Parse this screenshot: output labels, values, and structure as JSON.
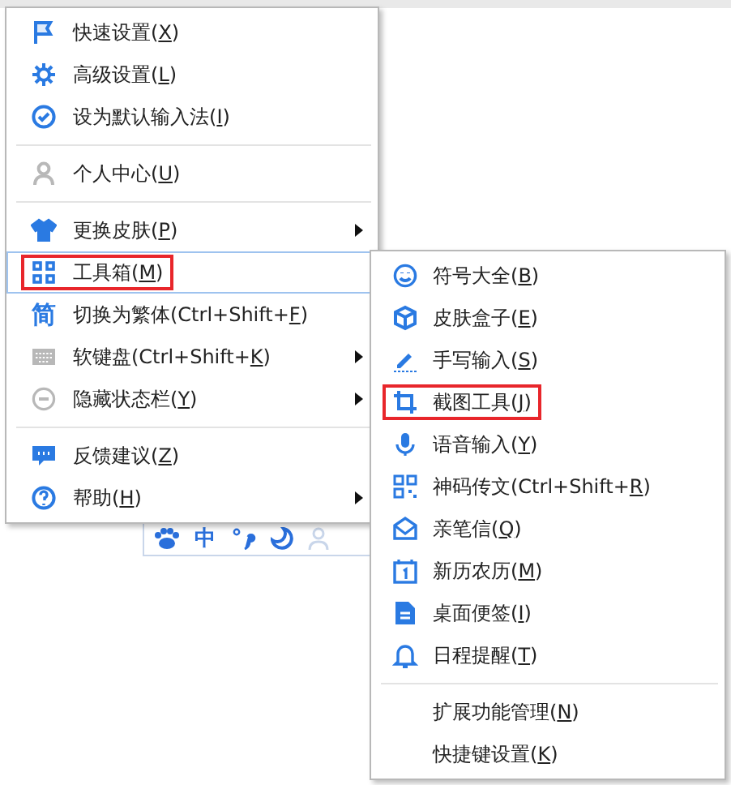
{
  "status_bar": {
    "mode_text": "中"
  },
  "main_menu": {
    "sections": [
      [
        {
          "text_before": "快速设置(",
          "mnemonic": "X",
          "text_after": ")",
          "has_submenu": false,
          "selected": false,
          "outlined": false
        },
        {
          "text_before": "高级设置(",
          "mnemonic": "L",
          "text_after": ")",
          "has_submenu": false,
          "selected": false,
          "outlined": false
        },
        {
          "text_before": "设为默认输入法(",
          "mnemonic": "I",
          "text_after": ")",
          "has_submenu": false,
          "selected": false,
          "outlined": false
        }
      ],
      [
        {
          "text_before": "个人中心(",
          "mnemonic": "U",
          "text_after": ")",
          "has_submenu": false,
          "selected": false,
          "outlined": false
        }
      ],
      [
        {
          "text_before": "更换皮肤(",
          "mnemonic": "P",
          "text_after": ")",
          "has_submenu": true,
          "selected": false,
          "outlined": false
        },
        {
          "text_before": "工具箱(",
          "mnemonic": "M",
          "text_after": ")",
          "has_submenu": false,
          "selected": true,
          "outlined": true
        },
        {
          "glyph": "简",
          "text_before": "切换为繁体(Ctrl+Shift+",
          "mnemonic": "F",
          "text_after": ")",
          "has_submenu": false,
          "selected": false,
          "outlined": false
        },
        {
          "text_before": "软键盘(Ctrl+Shift+",
          "mnemonic": "K",
          "text_after": ")",
          "has_submenu": true,
          "selected": false,
          "outlined": false
        },
        {
          "text_before": "隐藏状态栏(",
          "mnemonic": "Y",
          "text_after": ")",
          "has_submenu": true,
          "selected": false,
          "outlined": false
        }
      ],
      [
        {
          "text_before": "反馈建议(",
          "mnemonic": "Z",
          "text_after": ")",
          "has_submenu": false,
          "selected": false,
          "outlined": false
        },
        {
          "text_before": "帮助(",
          "mnemonic": "H",
          "text_after": ")",
          "has_submenu": true,
          "selected": false,
          "outlined": false
        }
      ]
    ]
  },
  "submenu": {
    "sections": [
      [
        {
          "text_before": "符号大全(",
          "mnemonic": "B",
          "text_after": ")",
          "outlined": false
        },
        {
          "text_before": "皮肤盒子(",
          "mnemonic": "E",
          "text_after": ")",
          "outlined": false
        },
        {
          "text_before": "手写输入(",
          "mnemonic": "S",
          "text_after": ")",
          "outlined": false
        },
        {
          "text_before": "截图工具(",
          "mnemonic": "J",
          "text_after": ")",
          "outlined": true
        },
        {
          "text_before": "语音输入(",
          "mnemonic": "Y",
          "text_after": ")",
          "outlined": false
        },
        {
          "text_before": "神码传文(Ctrl+Shift+",
          "mnemonic": "R",
          "text_after": ")",
          "outlined": false
        },
        {
          "text_before": "亲笔信(",
          "mnemonic": "Q",
          "text_after": ")",
          "outlined": false
        },
        {
          "text_before": "新历农历(",
          "mnemonic": "M",
          "text_after": ")",
          "outlined": false
        },
        {
          "text_before": "桌面便签(",
          "mnemonic": "I",
          "text_after": ")",
          "outlined": false
        },
        {
          "text_before": "日程提醒(",
          "mnemonic": "T",
          "text_after": ")",
          "outlined": false
        }
      ],
      [
        {
          "text_before": "扩展功能管理(",
          "mnemonic": "N",
          "text_after": ")",
          "outlined": false
        },
        {
          "text_before": "快捷键设置(",
          "mnemonic": "K",
          "text_after": ")",
          "outlined": false
        }
      ]
    ]
  }
}
